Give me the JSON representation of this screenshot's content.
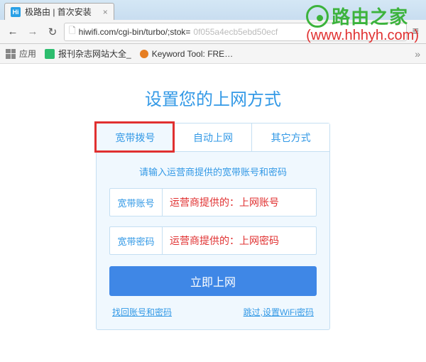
{
  "browser": {
    "tab_title": "极路由 | 首次安装",
    "favicon_text": "Hi",
    "url_visible": "hiwifi.com/cgi-bin/turbo/;stok=",
    "url_faded": "0f055a4ecb5ebd50ecf",
    "bookmarks": {
      "apps_label": "应用",
      "item1": "报刊杂志网站大全_",
      "item2": "Keyword Tool: FRE…"
    }
  },
  "page": {
    "title": "设置您的上网方式",
    "tabs": {
      "t1": "宽带拨号",
      "t2": "自动上网",
      "t3": "其它方式"
    },
    "hint": "请输入运营商提供的宽带账号和密码",
    "fields": {
      "account_label": "宽带账号",
      "account_value": "运营商提供的：上网账号",
      "password_label": "宽带密码",
      "password_value": "运营商提供的：上网密码"
    },
    "submit": "立即上网",
    "links": {
      "left": "找回账号和密码",
      "right": "跳过,设置WiFi密码"
    }
  },
  "watermark": {
    "brand": "路由之家",
    "url": "(www.hhhyh.com)"
  }
}
